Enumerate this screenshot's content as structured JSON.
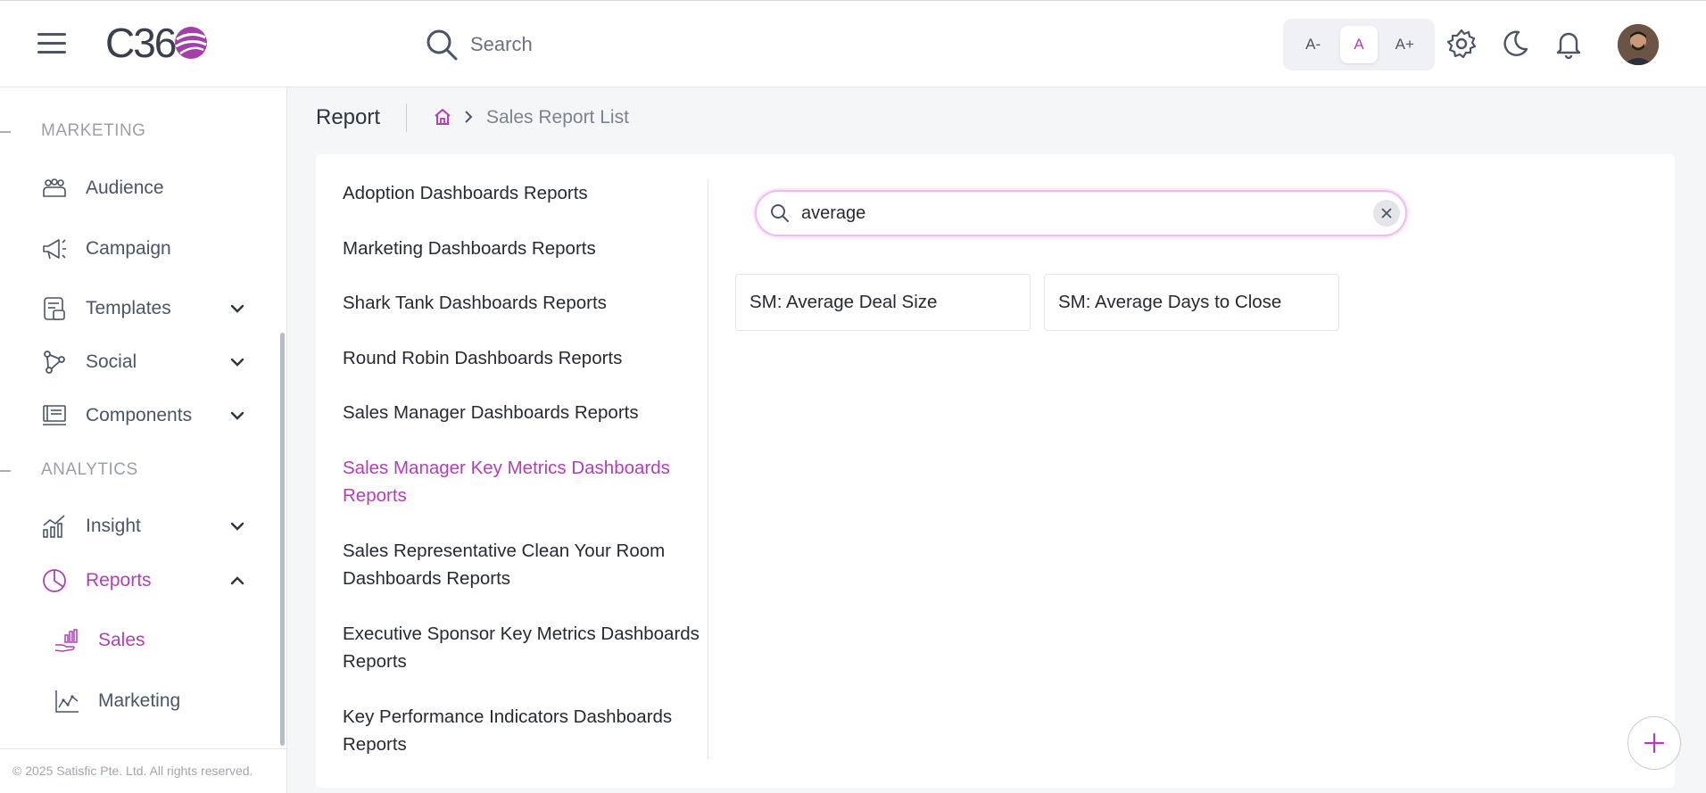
{
  "header": {
    "logo_text": "C36",
    "search_placeholder": "Search",
    "font_size_buttons": [
      "A-",
      "A",
      "A+"
    ]
  },
  "sidebar": {
    "sections": {
      "marketing": "MARKETING",
      "analytics": "ANALYTICS"
    },
    "items": {
      "audience": "Audience",
      "campaign": "Campaign",
      "templates": "Templates",
      "social": "Social",
      "components": "Components",
      "insight": "Insight",
      "reports": "Reports"
    },
    "sub_items": {
      "sales": "Sales",
      "marketing": "Marketing"
    },
    "footer": "© 2025 Satisfic Pte. Ltd. All rights reserved."
  },
  "page": {
    "title": "Report",
    "breadcrumb_current": "Sales Report List"
  },
  "report_categories": [
    "Adoption Dashboards Reports",
    "Marketing Dashboards Reports",
    "Shark Tank Dashboards Reports",
    "Round Robin Dashboards Reports",
    "Sales Manager Dashboards Reports",
    "Sales Manager Key Metrics Dashboards Reports",
    "Sales Representative Clean Your Room Dashboards Reports",
    "Executive Sponsor Key Metrics Dashboards Reports",
    "Key Performance Indicators Dashboards Reports"
  ],
  "active_category": "Sales Manager Key Metrics Dashboards Reports",
  "filter": {
    "value": "average"
  },
  "results": [
    "SM: Average Deal Size",
    "SM: Average Days to Close"
  ],
  "colors": {
    "accent": "#b13fb8",
    "text": "#262b33",
    "muted": "#9aa0a8"
  }
}
